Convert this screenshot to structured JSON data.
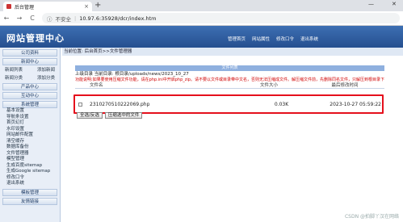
{
  "browser": {
    "tab_title": "后台管理",
    "tab_close": "×",
    "new_tab": "+",
    "win_min": "—",
    "win_close": "✕",
    "back": "←",
    "forward": "→",
    "reload": "C",
    "security_label": "不安全",
    "url": "10.97.6:35928/dcr/index.htm"
  },
  "header": {
    "logo": "网站管理中心",
    "nav": [
      "管理首页",
      "网站属性",
      "修改口令",
      "退出系统"
    ]
  },
  "sidebar": {
    "sections": [
      {
        "title": "公司资料",
        "items": []
      },
      {
        "title": "新闻中心",
        "pairs": [
          [
            "新闻列表",
            "添加新闻"
          ],
          [
            "新闻分类",
            "添加分类"
          ]
        ]
      },
      {
        "title": "产品中心",
        "items": []
      },
      {
        "title": "互动中心",
        "items": []
      },
      {
        "title": "系统管理",
        "items": [
          "基本设置",
          "导航条设置",
          "首页幻灯",
          "水印设置",
          "网站邮件配置",
          "清空缓存",
          "数据库备份",
          "文件管理器",
          "模型管理",
          "生成百度sitemap",
          "生成Google sitemap",
          "修改口令",
          "退出系统"
        ]
      },
      {
        "title": "模板管理",
        "items": []
      },
      {
        "title": "友情链接",
        "items": []
      }
    ]
  },
  "main": {
    "breadcrumb": "当前位置: 后台首页>>文件管理器",
    "panel_title": "文件列表",
    "dir_line": "上级目录 当前目录: 根目录/uploads/news/2023_10_27",
    "tip": "功能说明:如果要使用压缩文件功能，请在php.ini中开启php_zip。请不要以文件或目录带中文名，否则无法压缩成文件。解压缩文件前，先删除同名文件，只解压到根目录下",
    "columns": [
      "文件名",
      "文件大小",
      "最后修改时间"
    ],
    "files": [
      {
        "name": "2310270510222069.php",
        "size": "0.03K",
        "modified": "2023-10-27 05:59:22"
      }
    ],
    "buttons": [
      "全选/反选",
      "压缩选中的文件"
    ]
  },
  "watermark": "CSDN @拍脚丫汉在网络",
  "colors": {
    "highlight": "#e5101c",
    "header": "#2f5fa0",
    "tip": "#d10000"
  }
}
